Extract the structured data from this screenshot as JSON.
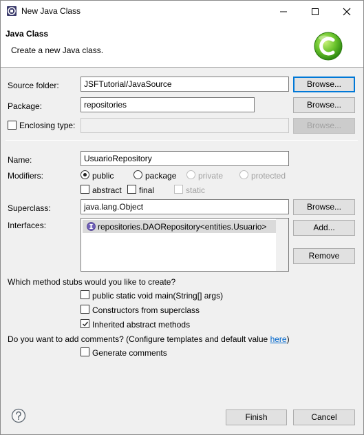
{
  "window": {
    "title": "New Java Class"
  },
  "banner": {
    "title": "Java Class",
    "description": "Create a new Java class."
  },
  "source_folder": {
    "label": "Source folder:",
    "value": "JSFTutorial/JavaSource",
    "browse_label": "Browse..."
  },
  "package": {
    "label": "Package:",
    "value": "repositories",
    "browse_label": "Browse..."
  },
  "enclosing_type": {
    "label": "Enclosing type:",
    "value": "",
    "checked": false,
    "browse_label": "Browse..."
  },
  "name": {
    "label": "Name:",
    "value": "UsuarioRepository"
  },
  "modifiers": {
    "label": "Modifiers:",
    "public": "public",
    "package": "package",
    "private": "private",
    "protected": "protected",
    "selected": "public",
    "abstract": "abstract",
    "final": "final",
    "static": "static"
  },
  "superclass": {
    "label": "Superclass:",
    "value": "java.lang.Object",
    "browse_label": "Browse..."
  },
  "interfaces": {
    "label": "Interfaces:",
    "items": [
      "repositories.DAORepository<entities.Usuario>"
    ],
    "add_label": "Add...",
    "remove_label": "Remove"
  },
  "method_stubs": {
    "question": "Which method stubs would you like to create?",
    "options": [
      {
        "label": "public static void main(String[] args)",
        "checked": false
      },
      {
        "label": "Constructors from superclass",
        "checked": false
      },
      {
        "label": "Inherited abstract methods",
        "checked": true
      }
    ]
  },
  "comments": {
    "question": "Do you want to add comments? (Configure templates and default value ",
    "link": "here",
    "question_end": ")",
    "generate_label": "Generate comments",
    "checked": false
  },
  "footer": {
    "finish_label": "Finish",
    "cancel_label": "Cancel"
  },
  "colors": {
    "accent": "#0078d7",
    "link": "#0066cc",
    "logo_green": "#5cb82e"
  }
}
